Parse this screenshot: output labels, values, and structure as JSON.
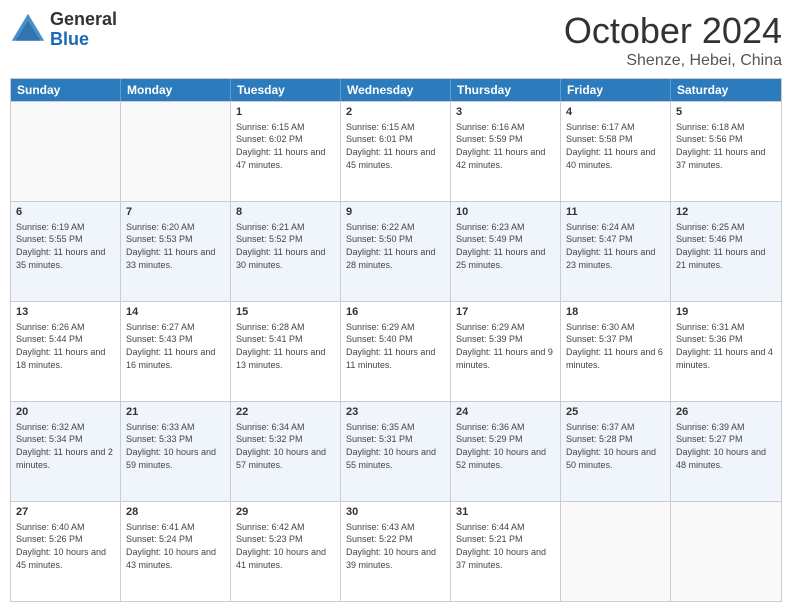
{
  "header": {
    "logo": {
      "general": "General",
      "blue": "Blue"
    },
    "title": "October 2024",
    "location": "Shenze, Hebei, China"
  },
  "weekdays": [
    "Sunday",
    "Monday",
    "Tuesday",
    "Wednesday",
    "Thursday",
    "Friday",
    "Saturday"
  ],
  "rows": [
    [
      {
        "day": "",
        "info": "",
        "empty": true
      },
      {
        "day": "",
        "info": "",
        "empty": true
      },
      {
        "day": "1",
        "info": "Sunrise: 6:15 AM\nSunset: 6:02 PM\nDaylight: 11 hours and 47 minutes."
      },
      {
        "day": "2",
        "info": "Sunrise: 6:15 AM\nSunset: 6:01 PM\nDaylight: 11 hours and 45 minutes."
      },
      {
        "day": "3",
        "info": "Sunrise: 6:16 AM\nSunset: 5:59 PM\nDaylight: 11 hours and 42 minutes."
      },
      {
        "day": "4",
        "info": "Sunrise: 6:17 AM\nSunset: 5:58 PM\nDaylight: 11 hours and 40 minutes."
      },
      {
        "day": "5",
        "info": "Sunrise: 6:18 AM\nSunset: 5:56 PM\nDaylight: 11 hours and 37 minutes."
      }
    ],
    [
      {
        "day": "6",
        "info": "Sunrise: 6:19 AM\nSunset: 5:55 PM\nDaylight: 11 hours and 35 minutes."
      },
      {
        "day": "7",
        "info": "Sunrise: 6:20 AM\nSunset: 5:53 PM\nDaylight: 11 hours and 33 minutes."
      },
      {
        "day": "8",
        "info": "Sunrise: 6:21 AM\nSunset: 5:52 PM\nDaylight: 11 hours and 30 minutes."
      },
      {
        "day": "9",
        "info": "Sunrise: 6:22 AM\nSunset: 5:50 PM\nDaylight: 11 hours and 28 minutes."
      },
      {
        "day": "10",
        "info": "Sunrise: 6:23 AM\nSunset: 5:49 PM\nDaylight: 11 hours and 25 minutes."
      },
      {
        "day": "11",
        "info": "Sunrise: 6:24 AM\nSunset: 5:47 PM\nDaylight: 11 hours and 23 minutes."
      },
      {
        "day": "12",
        "info": "Sunrise: 6:25 AM\nSunset: 5:46 PM\nDaylight: 11 hours and 21 minutes."
      }
    ],
    [
      {
        "day": "13",
        "info": "Sunrise: 6:26 AM\nSunset: 5:44 PM\nDaylight: 11 hours and 18 minutes."
      },
      {
        "day": "14",
        "info": "Sunrise: 6:27 AM\nSunset: 5:43 PM\nDaylight: 11 hours and 16 minutes."
      },
      {
        "day": "15",
        "info": "Sunrise: 6:28 AM\nSunset: 5:41 PM\nDaylight: 11 hours and 13 minutes."
      },
      {
        "day": "16",
        "info": "Sunrise: 6:29 AM\nSunset: 5:40 PM\nDaylight: 11 hours and 11 minutes."
      },
      {
        "day": "17",
        "info": "Sunrise: 6:29 AM\nSunset: 5:39 PM\nDaylight: 11 hours and 9 minutes."
      },
      {
        "day": "18",
        "info": "Sunrise: 6:30 AM\nSunset: 5:37 PM\nDaylight: 11 hours and 6 minutes."
      },
      {
        "day": "19",
        "info": "Sunrise: 6:31 AM\nSunset: 5:36 PM\nDaylight: 11 hours and 4 minutes."
      }
    ],
    [
      {
        "day": "20",
        "info": "Sunrise: 6:32 AM\nSunset: 5:34 PM\nDaylight: 11 hours and 2 minutes."
      },
      {
        "day": "21",
        "info": "Sunrise: 6:33 AM\nSunset: 5:33 PM\nDaylight: 10 hours and 59 minutes."
      },
      {
        "day": "22",
        "info": "Sunrise: 6:34 AM\nSunset: 5:32 PM\nDaylight: 10 hours and 57 minutes."
      },
      {
        "day": "23",
        "info": "Sunrise: 6:35 AM\nSunset: 5:31 PM\nDaylight: 10 hours and 55 minutes."
      },
      {
        "day": "24",
        "info": "Sunrise: 6:36 AM\nSunset: 5:29 PM\nDaylight: 10 hours and 52 minutes."
      },
      {
        "day": "25",
        "info": "Sunrise: 6:37 AM\nSunset: 5:28 PM\nDaylight: 10 hours and 50 minutes."
      },
      {
        "day": "26",
        "info": "Sunrise: 6:39 AM\nSunset: 5:27 PM\nDaylight: 10 hours and 48 minutes."
      }
    ],
    [
      {
        "day": "27",
        "info": "Sunrise: 6:40 AM\nSunset: 5:26 PM\nDaylight: 10 hours and 45 minutes."
      },
      {
        "day": "28",
        "info": "Sunrise: 6:41 AM\nSunset: 5:24 PM\nDaylight: 10 hours and 43 minutes."
      },
      {
        "day": "29",
        "info": "Sunrise: 6:42 AM\nSunset: 5:23 PM\nDaylight: 10 hours and 41 minutes."
      },
      {
        "day": "30",
        "info": "Sunrise: 6:43 AM\nSunset: 5:22 PM\nDaylight: 10 hours and 39 minutes."
      },
      {
        "day": "31",
        "info": "Sunrise: 6:44 AM\nSunset: 5:21 PM\nDaylight: 10 hours and 37 minutes."
      },
      {
        "day": "",
        "info": "",
        "empty": true
      },
      {
        "day": "",
        "info": "",
        "empty": true
      }
    ]
  ]
}
